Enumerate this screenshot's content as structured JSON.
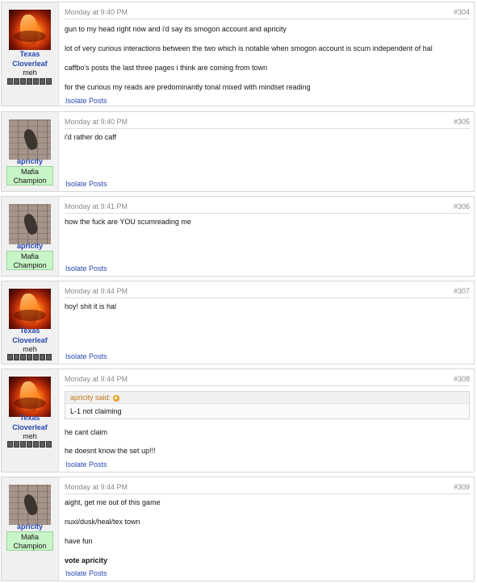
{
  "isolate_label": "Isolate Posts",
  "quote_icon": "arrow-up-circle-icon",
  "users": {
    "texas": {
      "name": "Texas Cloverleaf",
      "title": "meh",
      "avatar": "fire-avatar"
    },
    "apricity": {
      "name": "apricity",
      "badge_line1": "Mafia",
      "badge_line2": "Champion",
      "avatar": "squirrel-avatar"
    }
  },
  "posts": [
    {
      "time": "Monday at 9:40 PM",
      "number": "#304",
      "lines": [
        "gun to my head right now and i'd say its smogon account and apricity",
        "lot of very curious interactions between the two which is notable when smogon account is scum independent of hal",
        "caffbo's posts the last three pages i think are coming from town",
        "for the curious my reads are predominantly tonal mixed with mindset reading"
      ]
    },
    {
      "time": "Monday at 9:40 PM",
      "number": "#305",
      "lines": [
        "i'd rather do caff"
      ]
    },
    {
      "time": "Monday at 9:41 PM",
      "number": "#306",
      "lines": [
        "how the fuck are YOU scumreading me"
      ]
    },
    {
      "time": "Monday at 9:44 PM",
      "number": "#307",
      "lines": [
        "hoy! shit it is hal"
      ]
    },
    {
      "time": "Monday at 9:44 PM",
      "number": "#308",
      "quote": {
        "author": "apricity said:",
        "text": "L-1 not claiming"
      },
      "lines": [
        "he cant claim",
        "he doesnt know the set up!!!"
      ]
    },
    {
      "time": "Monday at 9:44 PM",
      "number": "#309",
      "lines": [
        "aight, get me out of this game",
        "nuxi/dusk/heal/tex town",
        "have fun",
        "vote apricity"
      ]
    }
  ]
}
